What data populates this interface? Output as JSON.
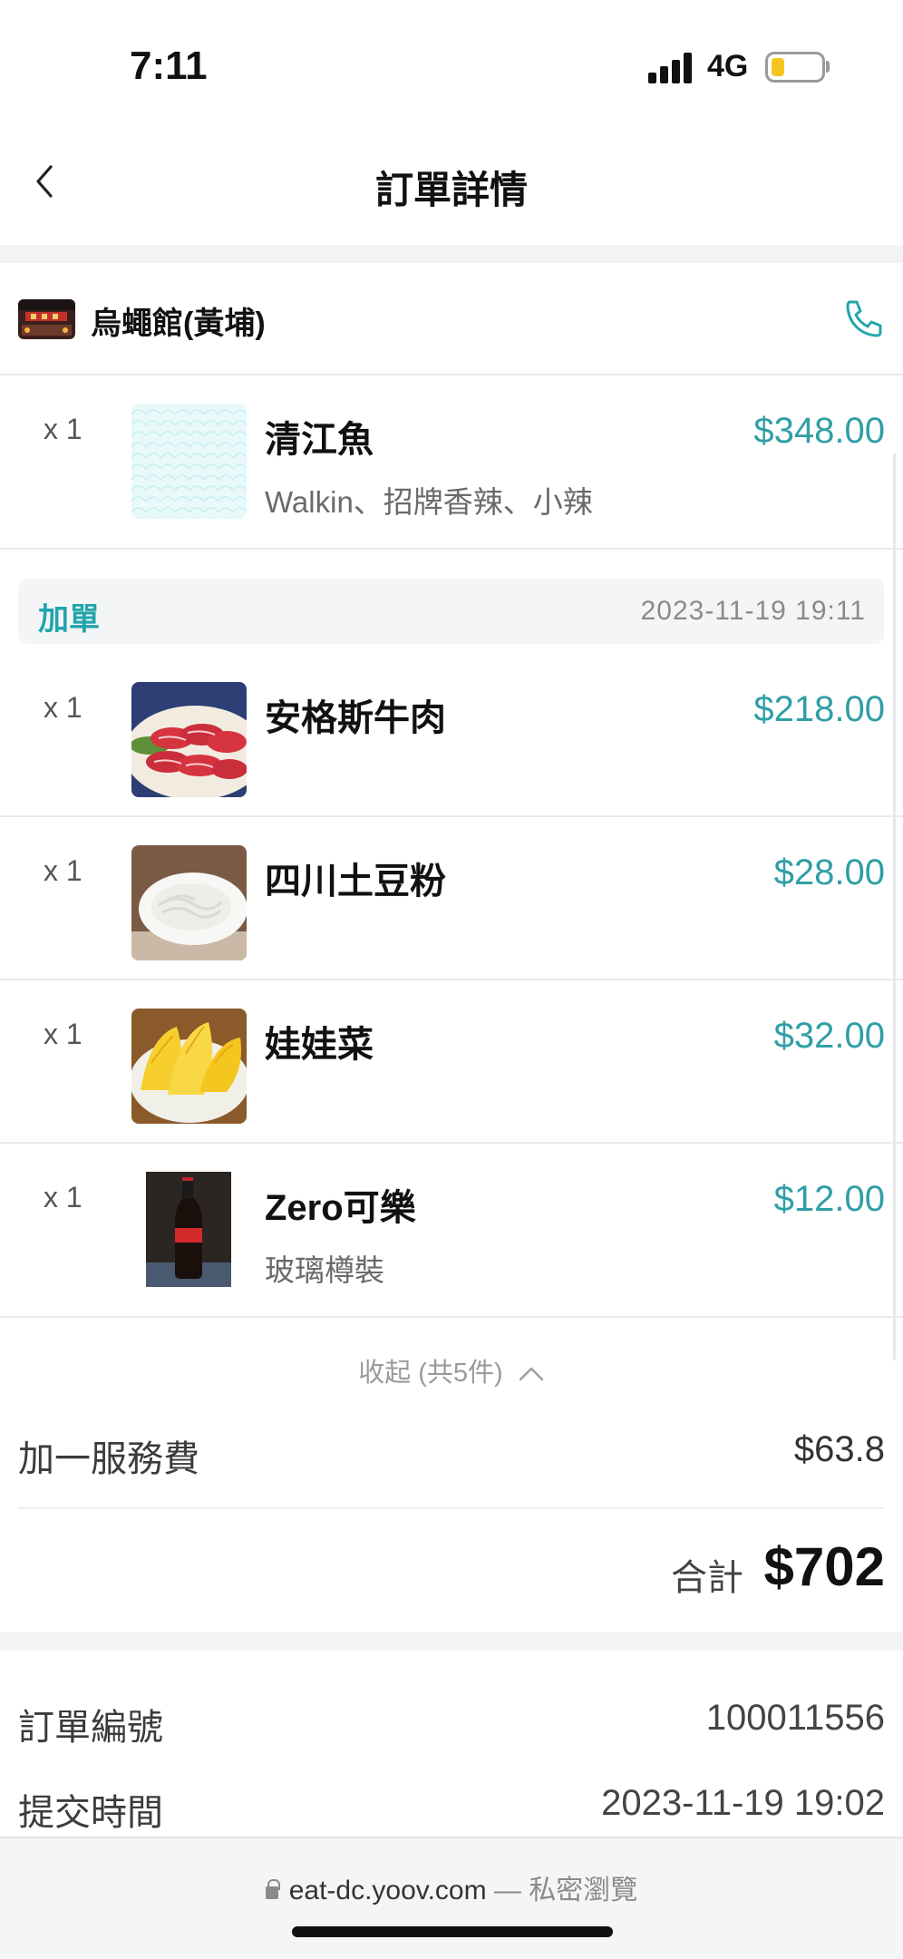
{
  "status_bar": {
    "time": "7:11",
    "network": "4G"
  },
  "header": {
    "title": "訂單詳情"
  },
  "restaurant": {
    "name": "烏蠅館(黃埔)"
  },
  "main_item": {
    "qty": "x 1",
    "name": "清江魚",
    "desc": "Walkin、招牌香辣、小辣",
    "price": "$348.00"
  },
  "addon": {
    "label": "加單",
    "time": "2023-11-19 19:11",
    "items": [
      {
        "qty": "x 1",
        "name": "安格斯牛肉",
        "price": "$218.00"
      },
      {
        "qty": "x 1",
        "name": "四川土豆粉",
        "price": "$28.00"
      },
      {
        "qty": "x 1",
        "name": "娃娃菜",
        "price": "$32.00"
      },
      {
        "qty": "x 1",
        "name": "Zero可樂",
        "desc": "玻璃樽裝",
        "price": "$12.00"
      }
    ]
  },
  "collapse_label": "收起 (共5件)",
  "service_fee": {
    "label": "加一服務費",
    "value": "$63.8"
  },
  "total": {
    "label": "合計",
    "value": "$702"
  },
  "order_info": {
    "number_label": "訂單編號",
    "number_value": "100011556",
    "time_label": "提交時間",
    "time_value": "2023-11-19 19:02"
  },
  "browser": {
    "url": "eat-dc.yoov.com",
    "mode": " — 私密瀏覽"
  },
  "colors": {
    "accent": "#2f9fa5",
    "addon_label": "#20a5ab"
  }
}
